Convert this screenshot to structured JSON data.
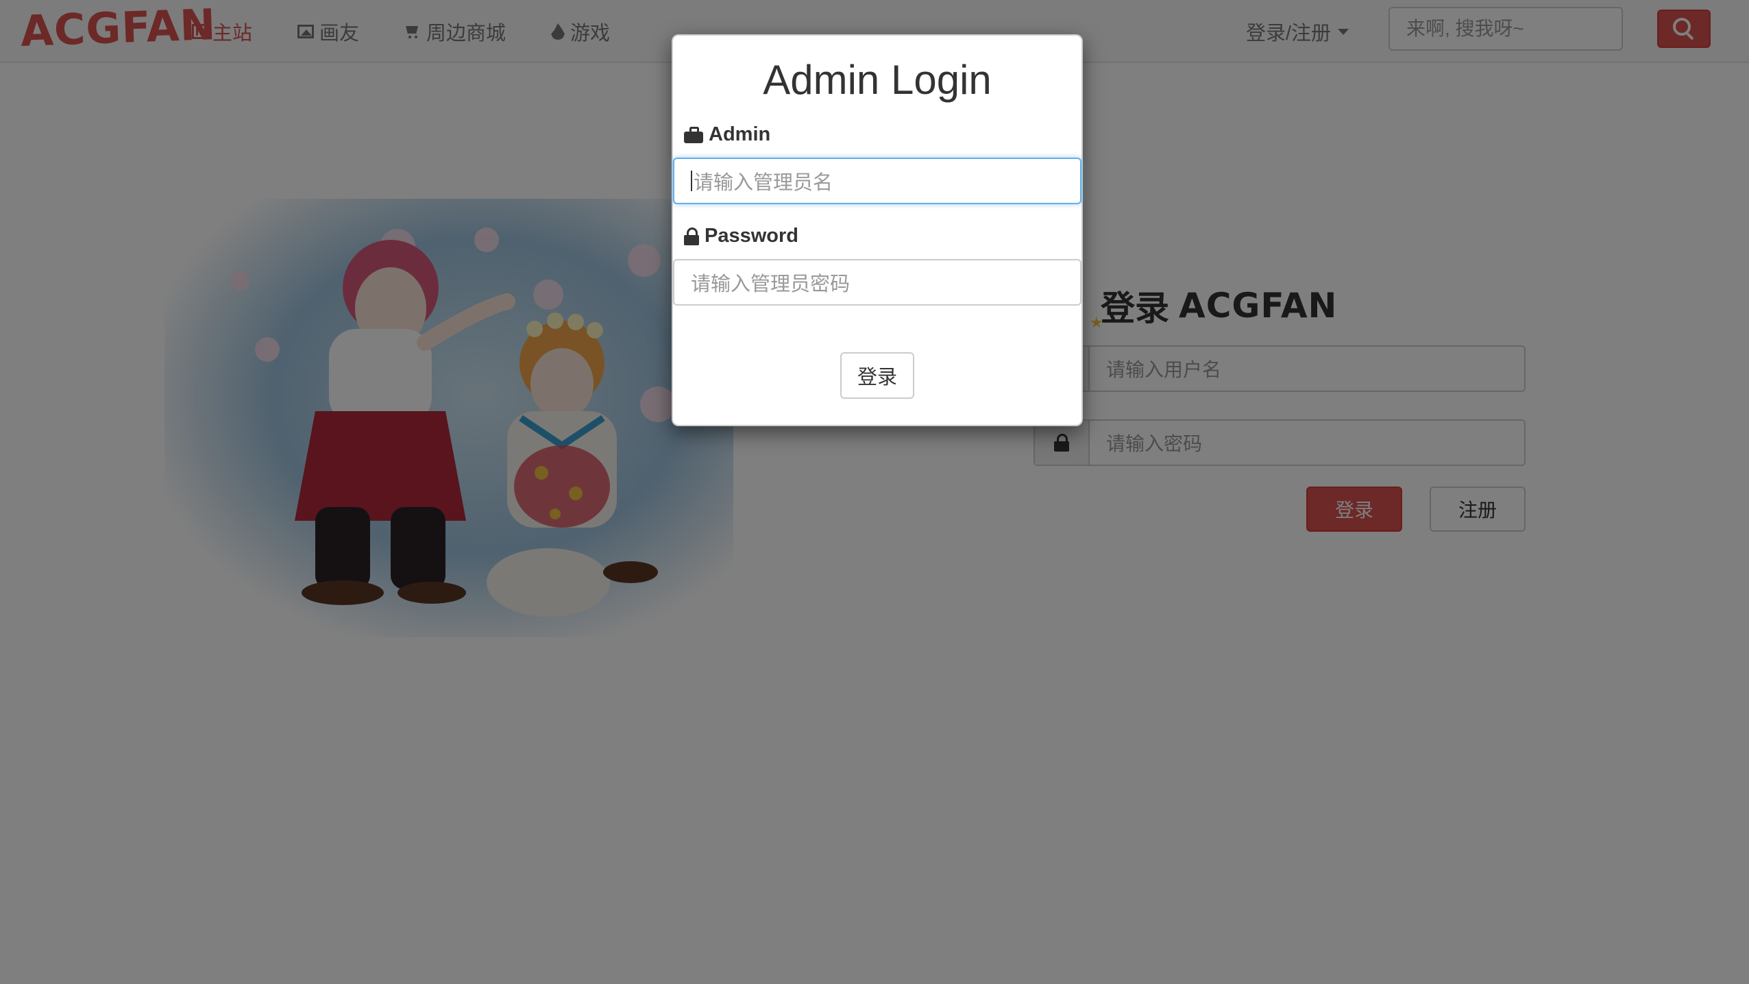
{
  "navbar": {
    "logo": "ACGFAN",
    "links": [
      {
        "label": "主站",
        "icon": "film-icon"
      },
      {
        "label": "画友",
        "icon": "picture-icon"
      },
      {
        "label": "周边商城",
        "icon": "shopping-cart-icon"
      },
      {
        "label": "游戏",
        "icon": "fire-icon"
      }
    ],
    "login_register": "登录/注册",
    "search_placeholder": "来啊, 搜我呀~"
  },
  "login_panel": {
    "title": "登录",
    "brand": "ACGFAN",
    "username_placeholder": "请输入用户名",
    "password_placeholder": "请输入密码",
    "login_button": "登录",
    "register_button": "注册"
  },
  "modal": {
    "title": "Admin Login",
    "admin_label": "Admin",
    "admin_placeholder": "请输入管理员名",
    "password_label": "Password",
    "password_placeholder": "请输入管理员密码",
    "submit_button": "登录"
  },
  "colors": {
    "accent": "#d9534f",
    "focus": "#66afe9",
    "backdrop": "rgba(0,0,0,0.5)"
  }
}
